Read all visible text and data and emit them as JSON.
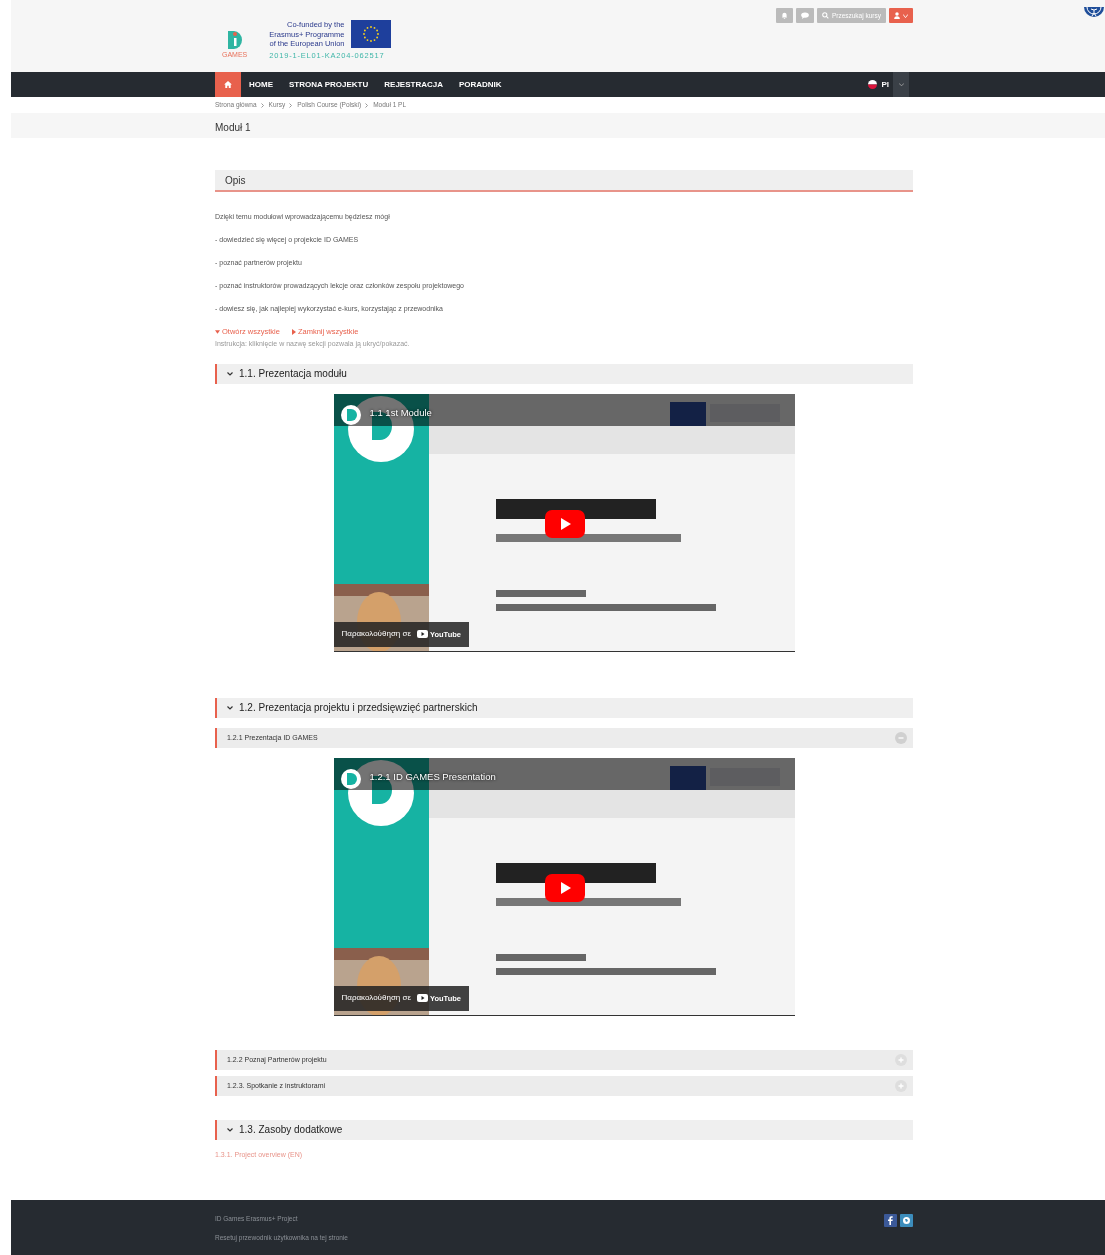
{
  "header": {
    "logo_text": "GAMES",
    "eu_lines": [
      "Co-funded by the",
      "Erasmus+ Programme",
      "of the European Union"
    ],
    "grant_code": "2019-1-EL01-KA204-062517",
    "search_label": "Przeszukaj kursy"
  },
  "navbar": {
    "items": [
      {
        "kind": "icon",
        "selected": true
      },
      {
        "kind": "text",
        "label": "HOME",
        "selected": false
      },
      {
        "kind": "text",
        "label": "STRONA PROJEKTU",
        "selected": false
      },
      {
        "kind": "text",
        "label": "REJESTRACJA",
        "selected": false
      },
      {
        "kind": "text",
        "label": "PORADNIK",
        "selected": false
      }
    ],
    "language": "Pl"
  },
  "breadcrumb": [
    "Strona główna",
    "Kursy",
    "Polish Course (Polski)",
    "Moduł 1 PL"
  ],
  "page_title": "Moduł 1",
  "description": {
    "title": "Opis",
    "paragraphs": [
      "Dzięki temu modułowi wprowadzającemu będziesz mógł",
      "- dowiedzieć się więcej o projekcie ID GAMES",
      "- poznać partnerów projektu",
      "- poznać instruktorów prowadzących lekcje oraz członków zespołu projektowego",
      "- dowiesz się, jak najlepiej wykorzystać e-kurs, korzystając z przewodnika"
    ]
  },
  "toggle_links": [
    {
      "kind": "expand",
      "label": "Otwórz wszystkie"
    },
    {
      "kind": "collapse",
      "label": "Zamknij wszystkie"
    }
  ],
  "instruction": "Instrukcja: kliknięcie w nazwę sekcji pozwala ją ukryć/pokazać.",
  "sections": [
    {
      "title": "1.1. Prezentacja modułu",
      "expanded": true,
      "content": [
        {
          "kind": "video",
          "title": "1.1 1st Module",
          "watch_label": "Παρακολούθηση σε",
          "brand": "YouTube"
        }
      ]
    },
    {
      "title": "1.2. Prezentacja projektu i przedsięwzięć partnerskich",
      "expanded": true,
      "content": [
        {
          "kind": "subsection",
          "title": "1.2.1 Prezentacja ID GAMES",
          "expanded": true
        },
        {
          "kind": "video",
          "title": "1.2.1 ID GAMES Presentation",
          "watch_label": "Παρακολούθηση σε",
          "brand": "YouTube"
        },
        {
          "kind": "subsection",
          "title": "1.2.2 Poznaj Partnerów projektu",
          "expanded": false
        },
        {
          "kind": "subsection",
          "title": "1.2.3. Spotkanie z instruktorami",
          "expanded": false
        }
      ]
    },
    {
      "title": "1.3. Zasoby dodatkowe",
      "expanded": true,
      "content": [
        {
          "kind": "link",
          "label": "1.3.1. Project overview (EN)"
        }
      ]
    }
  ],
  "footer": {
    "texts": [
      "ID Games Erasmus+ Project",
      "Resetuj przewodnik użytkownika na tej stronie"
    ]
  }
}
